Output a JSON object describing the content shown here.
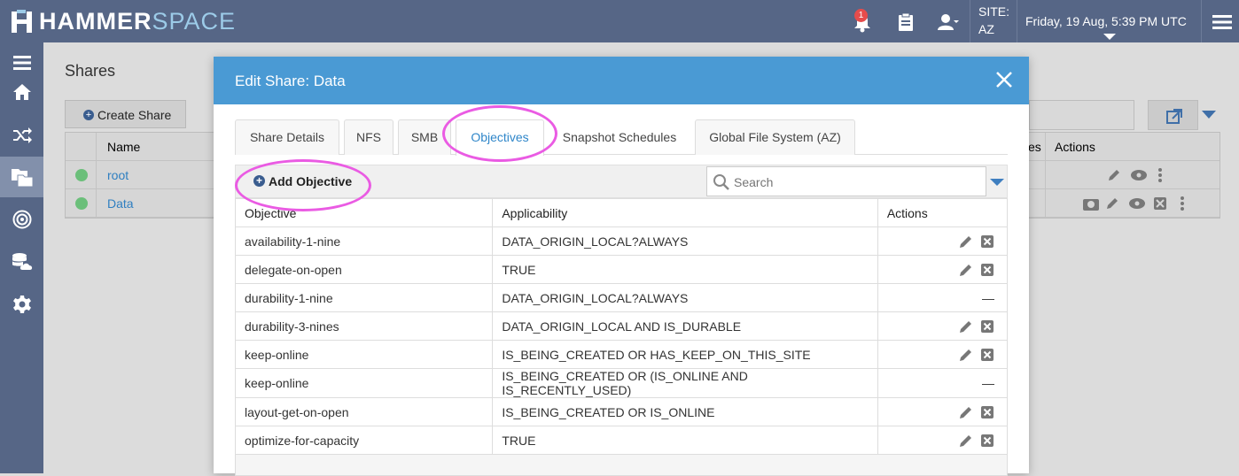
{
  "app": {
    "logo_hammer": "HAMMER",
    "logo_space": "SPACE",
    "notification_count": "1",
    "site_label": "SITE:",
    "site_value": "AZ",
    "datetime": "Friday, 19 Aug, 5:39 PM UTC"
  },
  "sidebar": {
    "items": [
      {
        "icon": "menu-icon"
      },
      {
        "icon": "home-icon"
      },
      {
        "icon": "shuffle-icon"
      },
      {
        "icon": "shares-icon",
        "active": true
      },
      {
        "icon": "target-icon"
      },
      {
        "icon": "cloud-storage-icon"
      },
      {
        "icon": "gear-icon"
      }
    ]
  },
  "page": {
    "title": "Shares",
    "create_button": "Create Share",
    "columns": {
      "name": "Name",
      "col_es": "es",
      "actions": "Actions"
    },
    "rows": [
      {
        "name": "root"
      },
      {
        "name": "Data"
      }
    ]
  },
  "modal": {
    "title": "Edit Share: Data",
    "tabs": [
      {
        "label": "Share Details"
      },
      {
        "label": "NFS"
      },
      {
        "label": "SMB"
      },
      {
        "label": "Objectives",
        "active": true
      },
      {
        "label": "Snapshot Schedules"
      },
      {
        "label": "Global File System (AZ)"
      }
    ],
    "add_button": "Add Objective",
    "search_placeholder": "Search",
    "columns": {
      "objective": "Objective",
      "applicability": "Applicability",
      "actions": "Actions"
    },
    "rows": [
      {
        "objective": "availability-1-nine",
        "applicability": "DATA_ORIGIN_LOCAL?ALWAYS",
        "editable": true
      },
      {
        "objective": "delegate-on-open",
        "applicability": "TRUE",
        "editable": true
      },
      {
        "objective": "durability-1-nine",
        "applicability": "DATA_ORIGIN_LOCAL?ALWAYS",
        "editable": false,
        "dash": "—"
      },
      {
        "objective": "durability-3-nines",
        "applicability": "DATA_ORIGIN_LOCAL AND IS_DURABLE",
        "editable": true
      },
      {
        "objective": "keep-online",
        "applicability": "IS_BEING_CREATED OR HAS_KEEP_ON_THIS_SITE",
        "editable": true
      },
      {
        "objective": "keep-online",
        "applicability": "IS_BEING_CREATED OR (IS_ONLINE AND IS_RECENTLY_USED)",
        "editable": false,
        "dash": "—"
      },
      {
        "objective": "layout-get-on-open",
        "applicability": "IS_BEING_CREATED OR IS_ONLINE",
        "editable": true
      },
      {
        "objective": "optimize-for-capacity",
        "applicability": "TRUE",
        "editable": true
      }
    ]
  },
  "colors": {
    "topbar": "#566686",
    "modal_header": "#4a9ad4",
    "active_tab": "#2f86c9",
    "highlight": "#ea5be3"
  }
}
